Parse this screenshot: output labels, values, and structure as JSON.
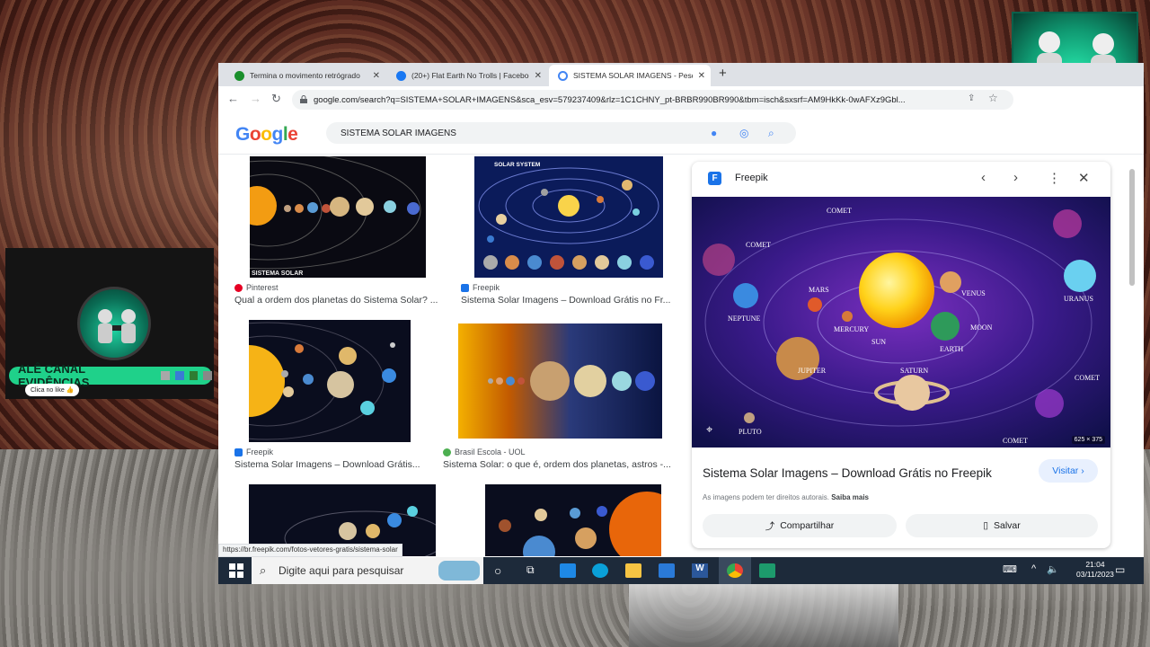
{
  "overlay": {
    "channel_name": "ALÊ CANAL EVIDÊNCIAS",
    "like_prompt": "Clica no like 👍"
  },
  "browser": {
    "tabs": [
      {
        "title": "Termina o movimento retrógrado",
        "icon": "green-circle-icon",
        "color": "#1a8f2c",
        "active": false
      },
      {
        "title": "(20+) Flat Earth No Trolls | Facebook",
        "icon": "facebook-icon",
        "color": "#1877f2",
        "active": false
      },
      {
        "title": "SISTEMA SOLAR IMAGENS - Pesquisa Google",
        "icon": "google-icon",
        "color": "#4285f4",
        "active": true
      }
    ],
    "url": "google.com/search?q=SISTEMA+SOLAR+IMAGENS&sca_esv=579237409&rlz=1C1CHNY_pt-BRBR990BR990&tbm=isch&sxsrf=AM9HkKk-0wAFXz9Gbl...",
    "status_url": "https://br.freepik.com/fotos-vetores-gratis/sistema-solar"
  },
  "search": {
    "logo": "Google",
    "query": "SISTEMA SOLAR IMAGENS"
  },
  "results": [
    {
      "source": "Pinterest",
      "title": "Qual a ordem dos planetas do Sistema Solar? ...",
      "fav_color": "#e60023",
      "caption": "SISTEMA SOLAR"
    },
    {
      "source": "Freepik",
      "title": "Sistema Solar Imagens – Download Grátis no Fr...",
      "fav_color": "#1a73e8",
      "caption": "SOLAR SYSTEM"
    },
    {
      "source": "Freepik",
      "title": "Sistema Solar Imagens – Download Grátis...",
      "fav_color": "#1a73e8"
    },
    {
      "source": "Brasil Escola - UOL",
      "title": "Sistema Solar: o que é, ordem dos planetas, astros -...",
      "fav_color": "#4caf50"
    }
  ],
  "preview": {
    "source": "Freepik",
    "title": "Sistema Solar Imagens – Download Grátis no Freepik",
    "visit": "Visitar",
    "rights": "As imagens podem ter direitos autorais.",
    "learn_more": "Saiba mais",
    "share": "Compartilhar",
    "save": "Salvar",
    "size": "625 × 375",
    "labels": [
      "COMET",
      "COMET",
      "MARS",
      "VENUS",
      "NEPTUNE",
      "MERCURY",
      "SUN",
      "MOON",
      "EARTH",
      "URANUS",
      "JUPITER",
      "SATURN",
      "COMET",
      "PLUTO",
      "COMET"
    ]
  },
  "taskbar": {
    "search_placeholder": "Digite aqui para pesquisar",
    "time": "21:04",
    "date": "03/11/2023"
  }
}
